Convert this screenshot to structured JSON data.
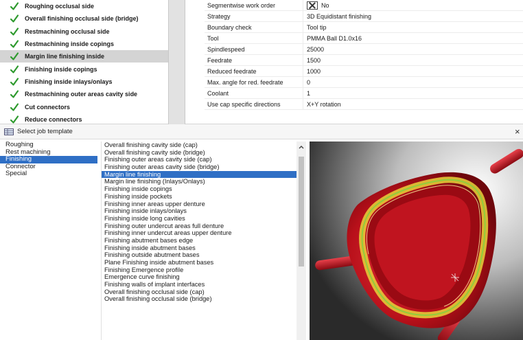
{
  "operations": [
    {
      "label": "Roughing occlusal side",
      "selected": false
    },
    {
      "label": "Overall finishing occlusal side (bridge)",
      "selected": false
    },
    {
      "label": "Restmachining occlusal side",
      "selected": false
    },
    {
      "label": "Restmachining inside copings",
      "selected": false
    },
    {
      "label": "Margin line finishing inside",
      "selected": true
    },
    {
      "label": "Finishing inside copings",
      "selected": false
    },
    {
      "label": "Finishing inside inlays/onlays",
      "selected": false
    },
    {
      "label": "Restmachining outer areas cavity side",
      "selected": false
    },
    {
      "label": "Cut connectors",
      "selected": false
    },
    {
      "label": "Reduce connectors",
      "selected": false
    }
  ],
  "properties": [
    {
      "name": "Segmentwise work order",
      "value": "No",
      "checkbox": true
    },
    {
      "name": "Strategy",
      "value": "3D Equidistant finishing"
    },
    {
      "name": "Boundary check",
      "value": "Tool tip"
    },
    {
      "name": "Tool",
      "value": "PMMA Ball D1.0x16"
    },
    {
      "name": "Spindlespeed",
      "value": "25000"
    },
    {
      "name": "Feedrate",
      "value": "1500"
    },
    {
      "name": "Reduced feedrate",
      "value": "1000"
    },
    {
      "name": "Max. angle for red. feedrate",
      "value": "0"
    },
    {
      "name": "Coolant",
      "value": "1"
    },
    {
      "name": "Use cap specific directions",
      "value": "X+Y rotation"
    }
  ],
  "dialog": {
    "title": "Select job template",
    "close_glyph": "×"
  },
  "categories": [
    {
      "label": "Roughing",
      "selected": false
    },
    {
      "label": "Rest machining",
      "selected": false
    },
    {
      "label": "Finishing",
      "selected": true
    },
    {
      "label": "Connector",
      "selected": false
    },
    {
      "label": "Special",
      "selected": false
    }
  ],
  "templates": [
    {
      "label": "Overall finishing cavity side (cap)",
      "selected": false
    },
    {
      "label": "Overall finishing cavity side (bridge)",
      "selected": false
    },
    {
      "label": "Finishing outer areas cavity side (cap)",
      "selected": false
    },
    {
      "label": "Finishing outer areas cavity side (bridge)",
      "selected": false
    },
    {
      "label": "Margin line finishing",
      "selected": true
    },
    {
      "label": "Margin line finishing (Inlays/Onlays)",
      "selected": false
    },
    {
      "label": "Finishing inside copings",
      "selected": false
    },
    {
      "label": "Finishing inside pockets",
      "selected": false
    },
    {
      "label": "Finishing inner areas upper denture",
      "selected": false
    },
    {
      "label": "Finishing inside inlays/onlays",
      "selected": false
    },
    {
      "label": "Finishing inside long cavities",
      "selected": false
    },
    {
      "label": "Finishing outer undercut areas full denture",
      "selected": false
    },
    {
      "label": "Finishing inner undercut areas upper denture",
      "selected": false
    },
    {
      "label": "Finishing abutment bases edge",
      "selected": false
    },
    {
      "label": "Finishing inside abutment bases",
      "selected": false
    },
    {
      "label": "Finishing outside abutment bases",
      "selected": false
    },
    {
      "label": "Plane Finishing inside abutment bases",
      "selected": false
    },
    {
      "label": "Finishing Emergence profile",
      "selected": false
    },
    {
      "label": "Emergence curve finishing",
      "selected": false
    },
    {
      "label": "Finishing walls of implant interfaces",
      "selected": false
    },
    {
      "label": "Overall finishing occlusal side (cap)",
      "selected": false
    },
    {
      "label": "Overall finishing occlusal side (bridge)",
      "selected": false
    }
  ],
  "icons": {
    "check": "green-check-icon",
    "dialog": "grid-table-icon",
    "scroll_up": "scroll-up-arrow-icon"
  },
  "colors": {
    "check_green": "#2e9a2e",
    "selection_blue": "#2f6fc5",
    "model_red": "#c4141f",
    "toolpath_yellow": "#e8d43a"
  }
}
